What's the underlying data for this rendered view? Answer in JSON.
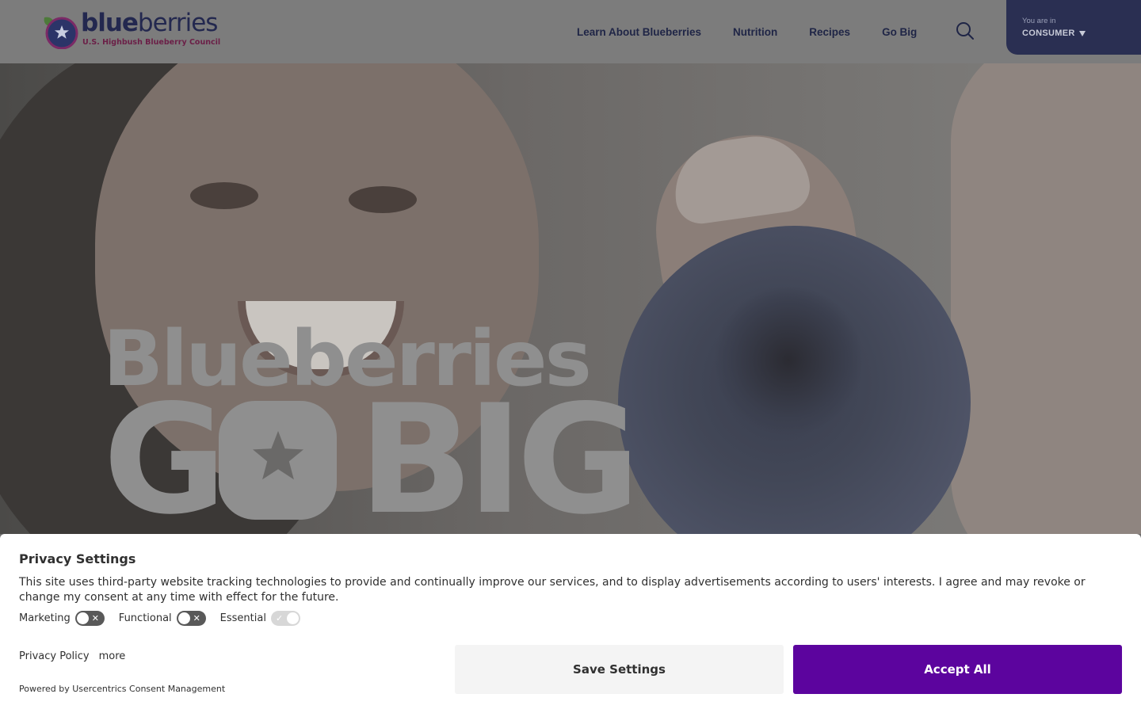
{
  "header": {
    "logo": {
      "word_bold": "blue",
      "word_regular": "berries",
      "subtitle": "U.S. Highbush Blueberry Council"
    },
    "nav": [
      {
        "label": "Learn About Blueberries"
      },
      {
        "label": "Nutrition"
      },
      {
        "label": "Recipes"
      },
      {
        "label": "Go Big"
      }
    ],
    "search_icon": "search-icon",
    "audience": {
      "prefix": "You are in",
      "value": "CONSUMER"
    }
  },
  "hero": {
    "line1": "Blueberries",
    "line2_part1": "G",
    "line2_part2": "BIG",
    "star_icon": "star-icon"
  },
  "consent": {
    "title": "Privacy Settings",
    "text": "This site uses third-party website tracking technologies to provide and continually improve our services, and to display advertisements according to users' interests. I agree and may revoke or change my consent at any time with effect for the future.",
    "toggles": [
      {
        "label": "Marketing",
        "state": "off"
      },
      {
        "label": "Functional",
        "state": "off"
      },
      {
        "label": "Essential",
        "state": "on"
      }
    ],
    "links": {
      "privacy_policy": "Privacy Policy",
      "more": "more"
    },
    "powered_by": "Powered by Usercentrics Consent Management",
    "buttons": {
      "save": "Save Settings",
      "accept": "Accept All"
    }
  },
  "colors": {
    "accent": "#5c049e",
    "header_dark": "#2a2f52",
    "nav_text": "#1f2546"
  }
}
